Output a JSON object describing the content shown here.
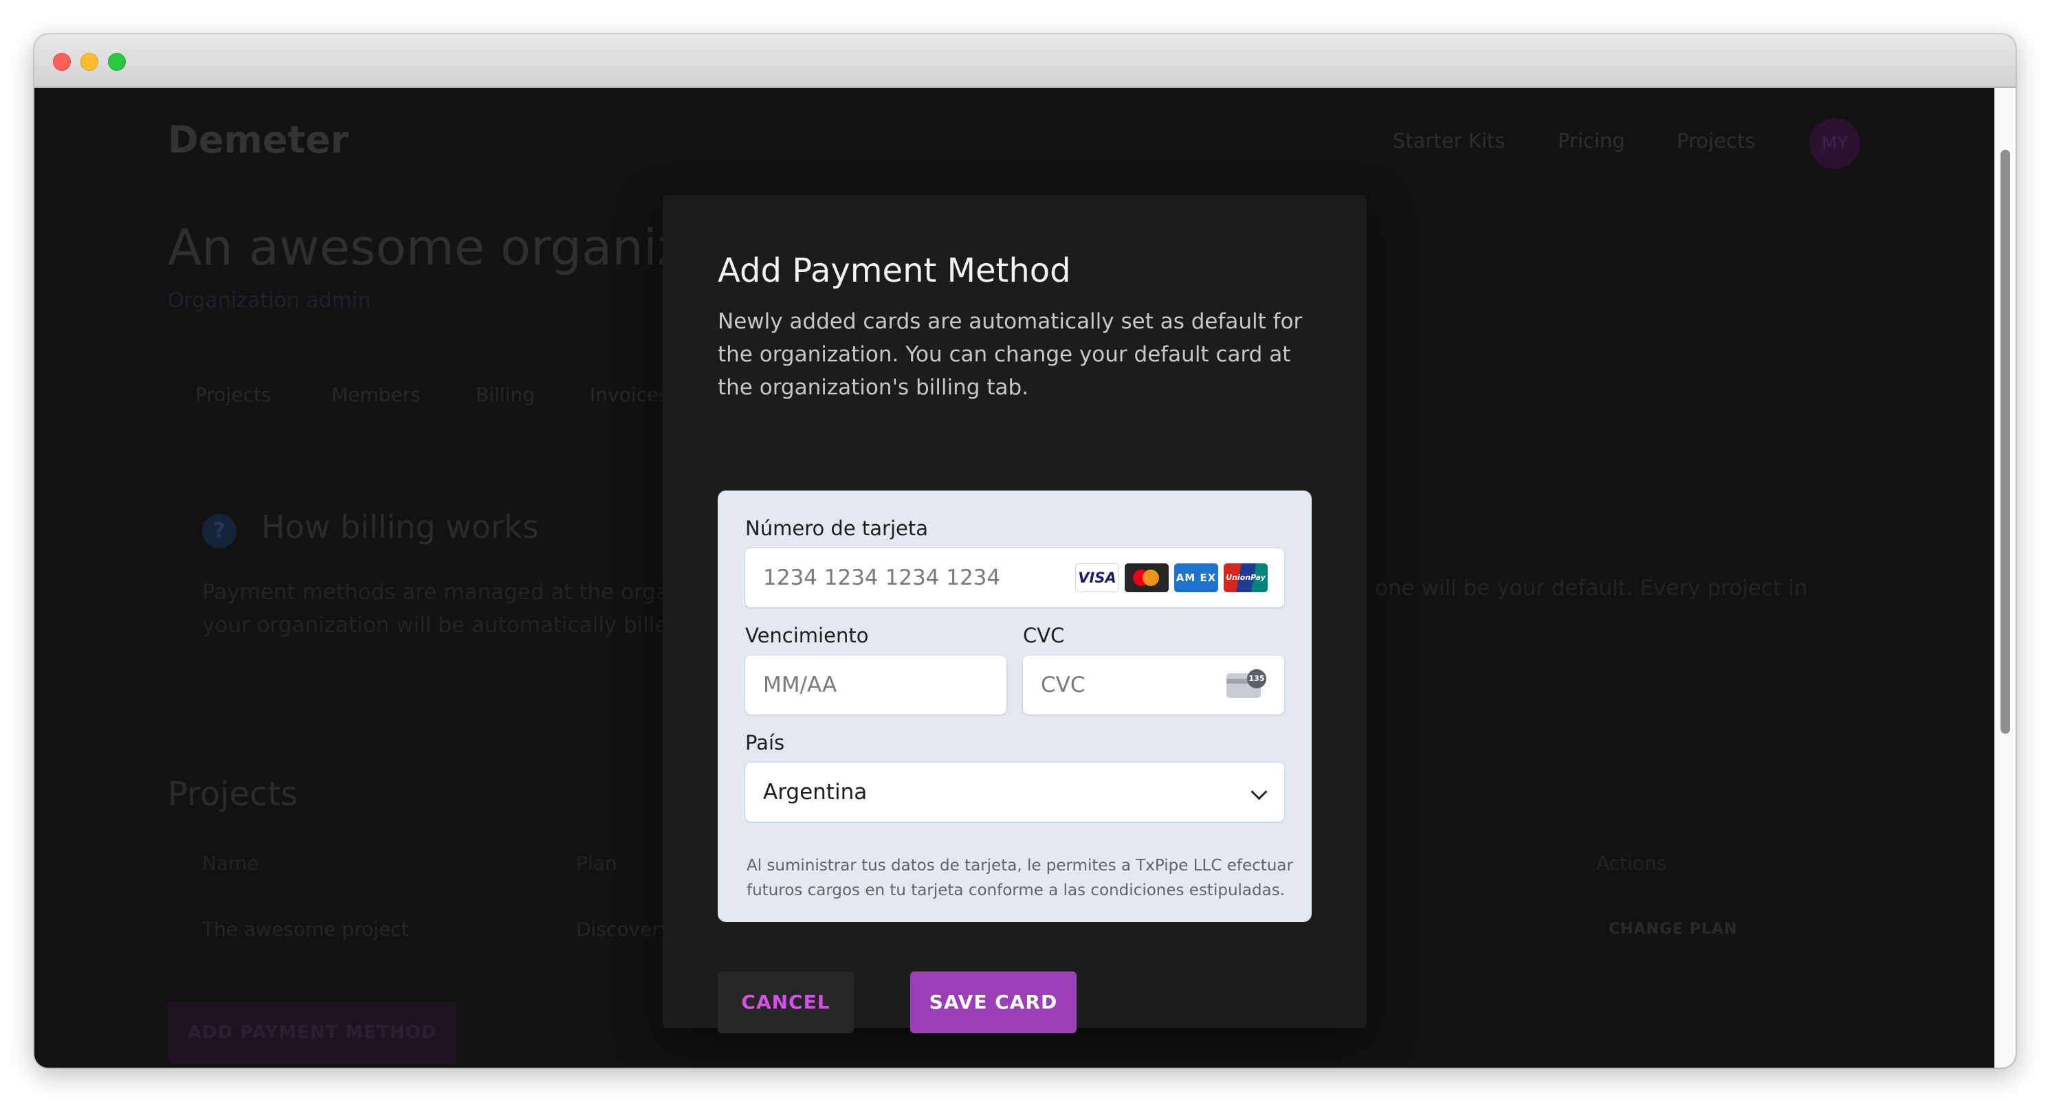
{
  "window": {
    "controls": [
      "close",
      "minimize",
      "zoom"
    ]
  },
  "background": {
    "brand": "Demeter",
    "nav": [
      "Starter Kits",
      "Pricing",
      "Projects"
    ],
    "avatar_initials": "MY",
    "org_title": "An awesome organization",
    "org_subtitle": "Organization admin",
    "tabs": [
      "Projects",
      "Members",
      "Billing",
      "Invoices"
    ],
    "help_title": "How billing works",
    "help_text": "Payment methods are managed at the organization level.",
    "help_text_right": "one will be your default. Every project in",
    "help_text_line2": "your organization will be automatically billed",
    "projects_title": "Projects",
    "columns": [
      "Name",
      "Plan",
      "Actions"
    ],
    "row": {
      "name": "The awesome project",
      "plan": "Discovery",
      "action": "CHANGE PLAN"
    },
    "add_button": "ADD PAYMENT METHOD"
  },
  "modal": {
    "title": "Add Payment Method",
    "description": "Newly added cards are automatically set as default for the organization. You can change your default card at the organization's billing tab.",
    "card_form": {
      "card_number_label": "Número de tarjeta",
      "card_number_placeholder": "1234 1234 1234 1234",
      "card_brands": [
        "visa",
        "mastercard",
        "amex",
        "unionpay"
      ],
      "visa_text": "VISA",
      "amex_text": "AM EX",
      "unionpay_text": "UnionPay",
      "expiry_label": "Vencimiento",
      "expiry_placeholder": "MM/AA",
      "cvc_label": "CVC",
      "cvc_placeholder": "CVC",
      "cvc_badge": "135",
      "country_label": "País",
      "country_value": "Argentina",
      "terms": "Al suministrar tus datos de tarjeta, le permites a TxPipe LLC efectuar futuros cargos en tu tarjeta conforme a las condiciones estipuladas."
    },
    "cancel_label": "CANCEL",
    "save_label": "SAVE CARD"
  },
  "colors": {
    "accent": "#9c3fb6",
    "accent_text": "#d64fe6",
    "modal_bg": "#1c1c1c",
    "form_bg": "#e4e9f1"
  }
}
